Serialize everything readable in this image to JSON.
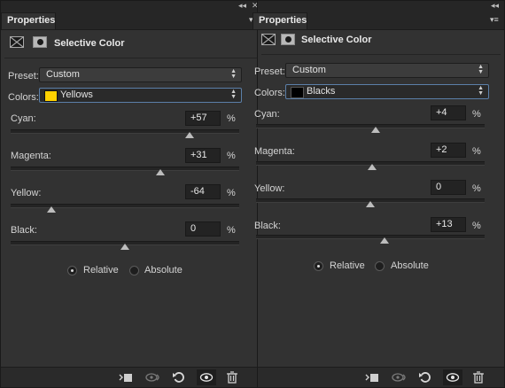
{
  "panels": [
    {
      "tab_label": "Properties",
      "title": "Selective Color",
      "preset": {
        "label": "Preset:",
        "value": "Custom"
      },
      "colors": {
        "label": "Colors:",
        "value": "Yellows",
        "swatch_color": "#ffd200"
      },
      "sliders": [
        {
          "label": "Cyan:",
          "value": "+57",
          "unit": "%",
          "numeric": 57
        },
        {
          "label": "Magenta:",
          "value": "+31",
          "unit": "%",
          "numeric": 31
        },
        {
          "label": "Yellow:",
          "value": "-64",
          "unit": "%",
          "numeric": -64
        },
        {
          "label": "Black:",
          "value": "0",
          "unit": "%",
          "numeric": 0
        }
      ],
      "method": {
        "relative_label": "Relative",
        "absolute_label": "Absolute",
        "selected": "relative"
      }
    },
    {
      "tab_label": "Properties",
      "title": "Selective Color",
      "preset": {
        "label": "Preset:",
        "value": "Custom"
      },
      "colors": {
        "label": "Colors:",
        "value": "Blacks",
        "swatch_color": "#000000"
      },
      "sliders": [
        {
          "label": "Cyan:",
          "value": "+4",
          "unit": "%",
          "numeric": 4
        },
        {
          "label": "Magenta:",
          "value": "+2",
          "unit": "%",
          "numeric": 2
        },
        {
          "label": "Yellow:",
          "value": "0",
          "unit": "%",
          "numeric": 0
        },
        {
          "label": "Black:",
          "value": "+13",
          "unit": "%",
          "numeric": 13
        }
      ],
      "method": {
        "relative_label": "Relative",
        "absolute_label": "Absolute",
        "selected": "relative"
      }
    }
  ],
  "icons": {
    "panel_menu": "panel-menu-icon",
    "collapse": "collapse-arrows-icon",
    "clip_to_layer": "clip-to-layer-icon",
    "view_previous": "view-previous-state-icon",
    "reset": "reset-icon",
    "visibility": "visibility-eye-icon",
    "delete": "trash-icon"
  },
  "colors": {
    "panel_bg": "#323232",
    "accent_focus": "#5b7fa8"
  }
}
